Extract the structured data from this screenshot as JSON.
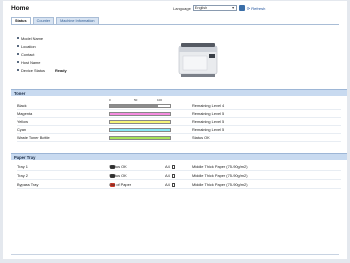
{
  "header": {
    "title": "Home",
    "language_label": "Language",
    "language_value": "English",
    "refresh_label": "Refresh"
  },
  "tabs": [
    {
      "label": "Status"
    },
    {
      "label": "Counter"
    },
    {
      "label": "Machine Information"
    }
  ],
  "device_info": [
    {
      "label": "Model Name",
      "value": ""
    },
    {
      "label": "Location",
      "value": ""
    },
    {
      "label": "Contact",
      "value": ""
    },
    {
      "label": "Host Name",
      "value": ""
    },
    {
      "label": "Device Status",
      "value": "Ready"
    }
  ],
  "toner": {
    "section_title": "Toner",
    "scale": [
      "0",
      "50",
      "100"
    ],
    "items": [
      {
        "name": "Black",
        "status": "Remaining Level 4",
        "color": "#8c8c8c",
        "level": 0.8
      },
      {
        "name": "Magenta",
        "status": "Remaining Level 5",
        "color": "#f68ce0",
        "level": 1.0
      },
      {
        "name": "Yellow",
        "status": "Remaining Level 5",
        "color": "#f6f47a",
        "level": 1.0
      },
      {
        "name": "Cyan",
        "status": "Remaining Level 5",
        "color": "#86e7f5",
        "level": 1.0
      },
      {
        "name": "Waste Toner Bottle",
        "status": "Status OK",
        "color": "#a8e25a",
        "level": 1.0
      }
    ]
  },
  "paper_tray": {
    "section_title": "Paper Tray",
    "items": [
      {
        "name": "Tray 1",
        "status": "Status OK",
        "size": "A4",
        "paper": "Middle Thick Paper (75-90g/m2)",
        "error": false
      },
      {
        "name": "Tray 2",
        "status": "Status OK",
        "size": "A4",
        "paper": "Middle Thick Paper (75-90g/m2)",
        "error": false
      },
      {
        "name": "Bypass Tray",
        "status": "Out of Paper",
        "size": "A4",
        "paper": "Middle Thick Paper (75-90g/m2)",
        "error": true
      }
    ]
  }
}
